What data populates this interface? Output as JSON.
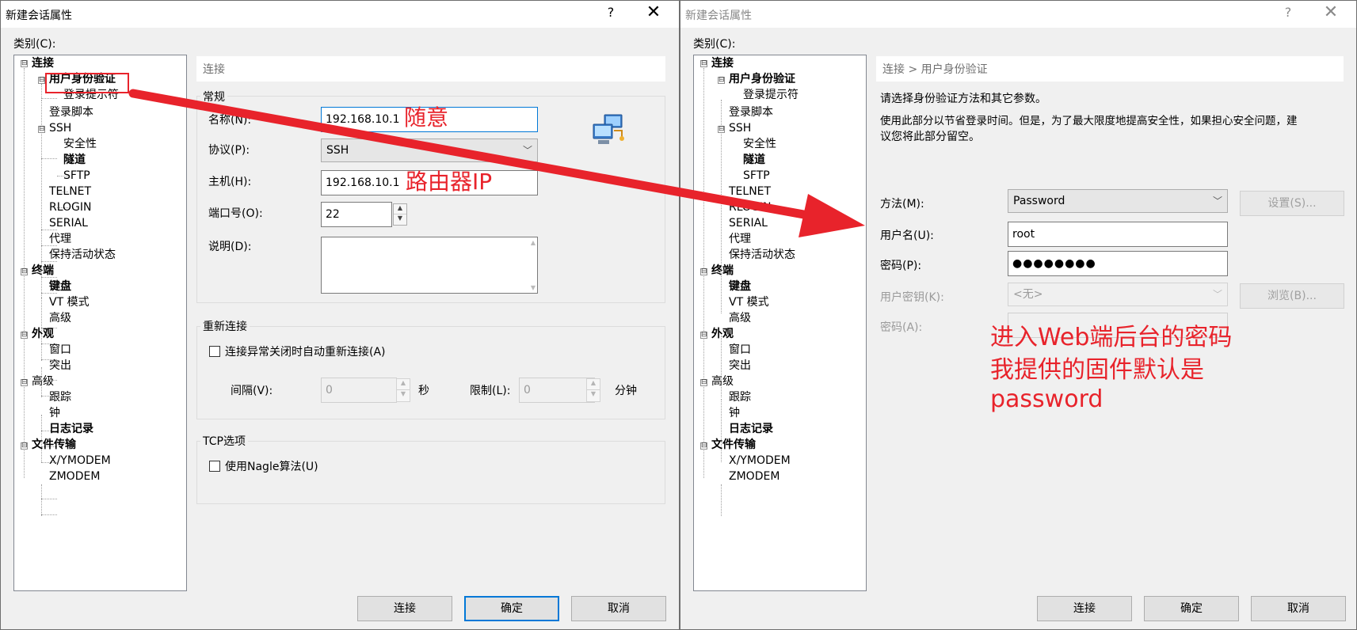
{
  "left_window": {
    "title": "新建会话属性",
    "help": "?",
    "close": "✕",
    "category_label": "类别(C):",
    "tree": [
      "连接",
      "用户身份验证",
      "登录提示符",
      "登录脚本",
      "SSH",
      "安全性",
      "隧道",
      "SFTP",
      "TELNET",
      "RLOGIN",
      "SERIAL",
      "代理",
      "保持活动状态",
      "终端",
      "键盘",
      "VT 模式",
      "高级",
      "外观",
      "窗口",
      "突出",
      "高级",
      "跟踪",
      "钟",
      "日志记录",
      "文件传输",
      "X/YMODEM",
      "ZMODEM"
    ],
    "expanders": [
      "⊟",
      "⊟",
      "⊟",
      "⊟",
      "⊟",
      "⊟",
      "⊟"
    ],
    "panel_header": "连接",
    "general_group": "常规",
    "name_label": "名称(N):",
    "name_value": "192.168.10.1",
    "protocol_label": "协议(P):",
    "protocol_value": "SSH",
    "host_label": "主机(H):",
    "host_value": "192.168.10.1",
    "port_label": "端口号(O):",
    "port_value": "22",
    "desc_label": "说明(D):",
    "reconnect_group": "重新连接",
    "reconnect_checkbox": "连接异常关闭时自动重新连接(A)",
    "interval_label": "间隔(V):",
    "interval_value": "0",
    "seconds": "秒",
    "limit_label": "限制(L):",
    "limit_value": "0",
    "minutes": "分钟",
    "tcp_group": "TCP选项",
    "nagle_checkbox": "使用Nagle算法(U)",
    "buttons": {
      "connect": "连接",
      "ok": "确定",
      "cancel": "取消"
    }
  },
  "right_window": {
    "title": "新建会话属性",
    "help": "?",
    "close": "✕",
    "category_label": "类别(C):",
    "tree": [
      "连接",
      "用户身份验证",
      "登录提示符",
      "登录脚本",
      "SSH",
      "安全性",
      "隧道",
      "SFTP",
      "TELNET",
      "RLOGIN",
      "SERIAL",
      "代理",
      "保持活动状态",
      "终端",
      "键盘",
      "VT 模式",
      "高级",
      "外观",
      "窗口",
      "突出",
      "高级",
      "跟踪",
      "钟",
      "日志记录",
      "文件传输",
      "X/YMODEM",
      "ZMODEM"
    ],
    "panel_header": "连接 > 用户身份验证",
    "intro1": "请选择身份验证方法和其它参数。",
    "intro2a": "使用此部分以节省登录时间。但是，为了最大限度地提高安全性，如果担心安全问题，建",
    "intro2b": "议您将此部分留空。",
    "method_label": "方法(M):",
    "method_value": "Password",
    "settings_button": "设置(S)...",
    "username_label": "用户名(U):",
    "username_value": "root",
    "password_label": "密码(P):",
    "password_value": "●●●●●●●●",
    "userkey_label": "用户密钥(K):",
    "userkey_value": "<无>",
    "browse_button": "浏览(B)...",
    "passphrase_label": "密码(A):",
    "buttons": {
      "connect": "连接",
      "ok": "确定",
      "cancel": "取消"
    }
  },
  "annotations": {
    "name_note": "随意",
    "host_note": "路由器IP",
    "password_note_1": "进入Web端后台的密码",
    "password_note_2": "我提供的固件默认是",
    "password_note_3": "password",
    "color": "#e8232b"
  }
}
